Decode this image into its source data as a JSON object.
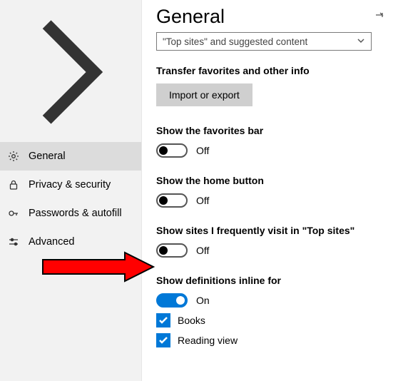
{
  "sidebar": {
    "items": [
      {
        "label": "General"
      },
      {
        "label": "Privacy & security"
      },
      {
        "label": "Passwords & autofill"
      },
      {
        "label": "Advanced"
      }
    ]
  },
  "header": {
    "title": "General"
  },
  "dropdown": {
    "value": "\"Top sites\" and suggested content"
  },
  "transfer": {
    "heading": "Transfer favorites and other info",
    "button": "Import or export"
  },
  "favorites_bar": {
    "heading": "Show the favorites bar",
    "state": "Off"
  },
  "home_button": {
    "heading": "Show the home button",
    "state": "Off"
  },
  "top_sites": {
    "heading": "Show sites I frequently visit in \"Top sites\"",
    "state": "Off"
  },
  "definitions": {
    "heading": "Show definitions inline for",
    "state": "On",
    "options": [
      {
        "label": "Books"
      },
      {
        "label": "Reading view"
      }
    ]
  }
}
